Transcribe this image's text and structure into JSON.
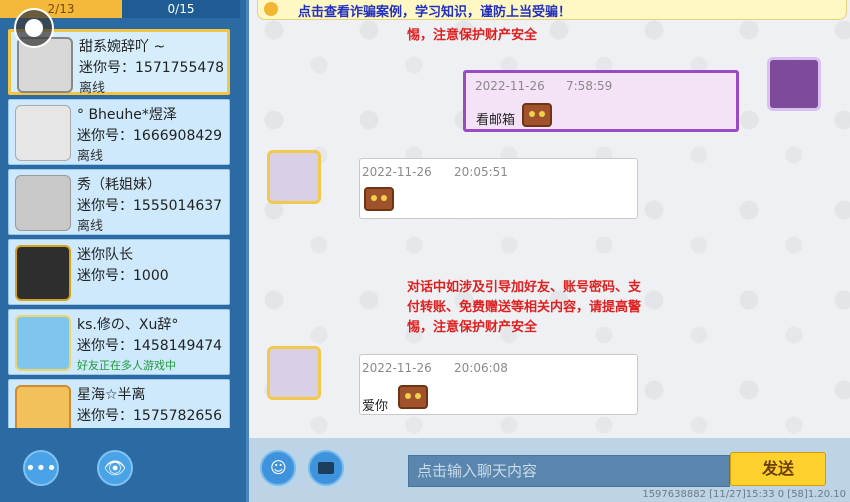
{
  "tabs": {
    "a": "2/13",
    "b": "0/15"
  },
  "friends": [
    {
      "name": "甜系婉辞吖 ~",
      "id": "迷你号：1571755478",
      "status": "离线"
    },
    {
      "name": "° Bheuhe*煜泽",
      "id": "迷你号：1666908429",
      "status": "离线"
    },
    {
      "name": "秀（耗姐妹）",
      "id": "迷你号：1555014637",
      "status": "离线"
    },
    {
      "name": "迷你队长",
      "id": "迷你号：1000",
      "status": ""
    },
    {
      "name": "ks.修の、Xu辞°",
      "id": "迷你号：1458149474",
      "status": "好友正在多人游戏中"
    },
    {
      "name": "星海☆半离",
      "id": "迷你号：1575782656",
      "status": ""
    }
  ],
  "notice": "点击查看诈骗案例，学习知识，谨防上当受骗！",
  "sys1": "惕，注意保护财产安全",
  "msg1": {
    "time": "2022-11-26",
    "clock": "7:58:59",
    "text": "看邮箱"
  },
  "msg2": {
    "time": "2022-11-26",
    "clock": "20:05:51"
  },
  "sys2": [
    "对话中如涉及引导加好友、账号密码、支",
    "付转账、免费赠送等相关内容，请提高警",
    "惕，注意保护财产安全"
  ],
  "msg3": {
    "time": "2022-11-26",
    "clock": "20:06:08",
    "text": "爱你"
  },
  "input_placeholder": "点击输入聊天内容",
  "send_label": "发送",
  "status_bar": "1597638882  [11/27]15:33 0  [58]1.20.10"
}
